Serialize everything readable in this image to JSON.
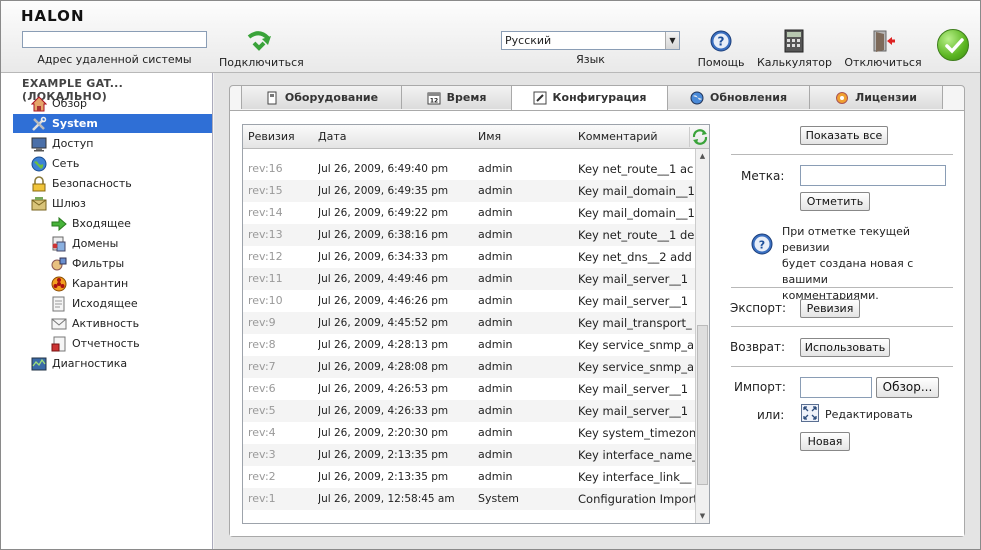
{
  "app": {
    "logo": "HALON"
  },
  "header": {
    "remote_label": "Адрес удаленной системы",
    "connect": "Подключиться",
    "lang_value": "Русский",
    "lang_label": "Язык",
    "help": "Помощь",
    "calc": "Калькулятор",
    "disconnect": "Отключиться"
  },
  "sidebar": {
    "title": "EXAMPLE GAT... (ЛОКАЛЬНО)",
    "items": [
      {
        "label": "Обзор"
      },
      {
        "label": "System"
      },
      {
        "label": "Доступ"
      },
      {
        "label": "Сеть"
      },
      {
        "label": "Безопасность"
      },
      {
        "label": "Шлюз"
      },
      {
        "label": "Входящее"
      },
      {
        "label": "Домены"
      },
      {
        "label": "Фильтры"
      },
      {
        "label": "Карантин"
      },
      {
        "label": "Исходящее"
      },
      {
        "label": "Активность"
      },
      {
        "label": "Отчетность"
      },
      {
        "label": "Диагностика"
      }
    ]
  },
  "tabs": [
    {
      "label": "Оборудование"
    },
    {
      "label": "Время"
    },
    {
      "label": "Конфигурация"
    },
    {
      "label": "Обновления"
    },
    {
      "label": "Лицензии"
    }
  ],
  "table": {
    "headers": {
      "rev": "Ревизия",
      "date": "Дата",
      "name": "Имя",
      "comment": "Комментарий"
    },
    "rows": [
      {
        "rev": "rev:16",
        "date": "Jul 26, 2009, 6:49:40 pm",
        "name": "admin",
        "comment": "Key net_route__1 ac"
      },
      {
        "rev": "rev:15",
        "date": "Jul 26, 2009, 6:49:35 pm",
        "name": "admin",
        "comment": "Key mail_domain__1"
      },
      {
        "rev": "rev:14",
        "date": "Jul 26, 2009, 6:49:22 pm",
        "name": "admin",
        "comment": "Key mail_domain__1"
      },
      {
        "rev": "rev:13",
        "date": "Jul 26, 2009, 6:38:16 pm",
        "name": "admin",
        "comment": "Key net_route__1 de"
      },
      {
        "rev": "rev:12",
        "date": "Jul 26, 2009, 6:34:33 pm",
        "name": "admin",
        "comment": "Key net_dns__2 add"
      },
      {
        "rev": "rev:11",
        "date": "Jul 26, 2009, 4:49:46 pm",
        "name": "admin",
        "comment": "Key mail_server__1"
      },
      {
        "rev": "rev:10",
        "date": "Jul 26, 2009, 4:46:26 pm",
        "name": "admin",
        "comment": "Key mail_server__1"
      },
      {
        "rev": "rev:9",
        "date": "Jul 26, 2009, 4:45:52 pm",
        "name": "admin",
        "comment": "Key mail_transport_"
      },
      {
        "rev": "rev:8",
        "date": "Jul 26, 2009, 4:28:13 pm",
        "name": "admin",
        "comment": "Key service_snmp_a"
      },
      {
        "rev": "rev:7",
        "date": "Jul 26, 2009, 4:28:08 pm",
        "name": "admin",
        "comment": "Key service_snmp_a"
      },
      {
        "rev": "rev:6",
        "date": "Jul 26, 2009, 4:26:53 pm",
        "name": "admin",
        "comment": "Key mail_server__1"
      },
      {
        "rev": "rev:5",
        "date": "Jul 26, 2009, 4:26:33 pm",
        "name": "admin",
        "comment": "Key mail_server__1"
      },
      {
        "rev": "rev:4",
        "date": "Jul 26, 2009, 2:20:30 pm",
        "name": "admin",
        "comment": "Key system_timezon"
      },
      {
        "rev": "rev:3",
        "date": "Jul 26, 2009, 2:13:35 pm",
        "name": "admin",
        "comment": "Key interface_name_"
      },
      {
        "rev": "rev:2",
        "date": "Jul 26, 2009, 2:13:35 pm",
        "name": "admin",
        "comment": "Key interface_link__"
      },
      {
        "rev": "rev:1",
        "date": "Jul 26, 2009, 12:58:45 am",
        "name": "System",
        "comment": "Configuration Import"
      }
    ]
  },
  "right": {
    "show_all": "Показать все",
    "label_label": "Метка:",
    "mark_button": "Отметить",
    "info_text_1": "При отметке текущей ревизии",
    "info_text_2": "будет создана новая с вашими",
    "info_text_3": "комментариями.",
    "export_label": "Экспорт:",
    "export_button": "Ревизия",
    "restore_label": "Возврат:",
    "restore_button": "Использовать",
    "import_label": "Импорт:",
    "browse_button": "Обзор...",
    "or_label": "или:",
    "edit_label": "Редактировать",
    "new_button": "Новая"
  }
}
